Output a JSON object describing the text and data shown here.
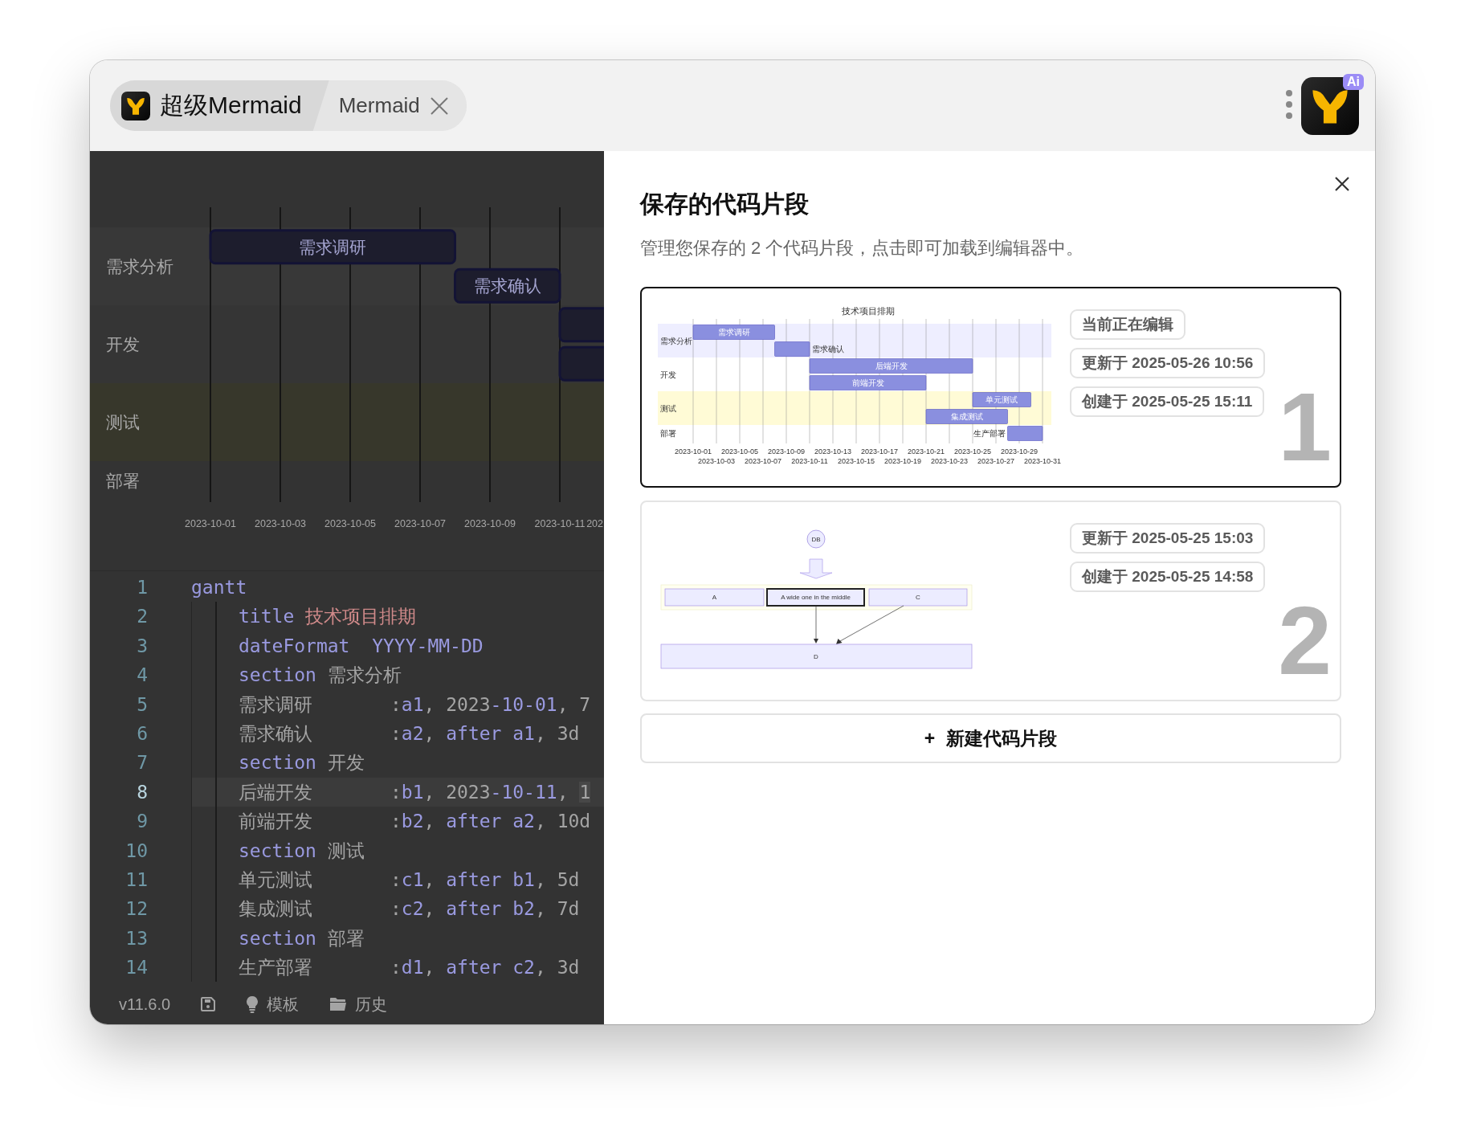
{
  "title_bar": {
    "tabs": [
      {
        "label": "超级Mermaid",
        "kind": "app",
        "selected": true
      },
      {
        "label": "Mermaid",
        "kind": "document",
        "selected": false
      }
    ],
    "assistant_badge": "Ai"
  },
  "preview": {
    "sections": [
      {
        "label": "需求分析",
        "tasks": [
          {
            "label": "需求调研",
            "kind": "labeled"
          },
          {
            "label": "需求确认",
            "kind": "labeled"
          }
        ]
      },
      {
        "label": "开发",
        "tasks": [
          {
            "kind": "bar"
          },
          {
            "kind": "bar"
          }
        ]
      },
      {
        "label": "测试"
      },
      {
        "label": "部署"
      }
    ],
    "axis_labels": [
      "2023-10-01",
      "2023-10-03",
      "2023-10-05",
      "2023-10-07",
      "2023-10-09",
      "2023-10-11",
      "202"
    ]
  },
  "editor": {
    "lines": [
      {
        "number": "1",
        "current": false,
        "tokens": [
          {
            "text": "gantt",
            "kind": "keyword"
          }
        ],
        "children": [
          {
            "number": "2",
            "current": false,
            "tokens": [
              {
                "text": "title",
                "kind": "keyword"
              },
              {
                "text": " 技术项目排期",
                "kind": "string"
              }
            ]
          },
          {
            "number": "3",
            "current": false,
            "tokens": [
              {
                "text": "dateFormat  YYYY-MM-DD",
                "kind": "keyword"
              }
            ]
          },
          {
            "number": "4",
            "current": false,
            "tokens": [
              {
                "text": "section",
                "kind": "keyword"
              },
              {
                "text": " 需求分析",
                "kind": "plain"
              }
            ]
          },
          {
            "number": "5",
            "current": false,
            "tokens": [
              {
                "text": "需求调研       :",
                "kind": "plain"
              },
              {
                "text": "a1",
                "kind": "keyword"
              },
              {
                "text": ", 2023",
                "kind": "plain"
              },
              {
                "text": "-10-01",
                "kind": "keyword"
              },
              {
                "text": ", 7",
                "kind": "plain"
              }
            ]
          },
          {
            "number": "6",
            "current": false,
            "tokens": [
              {
                "text": "需求确认       :",
                "kind": "plain"
              },
              {
                "text": "a2",
                "kind": "keyword"
              },
              {
                "text": ", ",
                "kind": "plain"
              },
              {
                "text": "after a1",
                "kind": "keyword"
              },
              {
                "text": ", 3d",
                "kind": "plain"
              }
            ]
          },
          {
            "number": "7",
            "current": false,
            "tokens": [
              {
                "text": "section",
                "kind": "keyword"
              },
              {
                "text": " 开发",
                "kind": "plain"
              }
            ]
          },
          {
            "number": "8",
            "current": true,
            "tokens": [
              {
                "text": "后端开发       :",
                "kind": "plain"
              },
              {
                "text": "b1",
                "kind": "keyword"
              },
              {
                "text": ", 2023",
                "kind": "plain"
              },
              {
                "text": "-10-11",
                "kind": "keyword"
              },
              {
                "text": ", ",
                "kind": "plain"
              },
              {
                "text": "1",
                "kind": "cursor"
              }
            ]
          },
          {
            "number": "9",
            "current": false,
            "tokens": [
              {
                "text": "前端开发       :",
                "kind": "plain"
              },
              {
                "text": "b2",
                "kind": "keyword"
              },
              {
                "text": ", ",
                "kind": "plain"
              },
              {
                "text": "after a2",
                "kind": "keyword"
              },
              {
                "text": ", 10d",
                "kind": "plain"
              }
            ]
          },
          {
            "number": "10",
            "current": false,
            "tokens": [
              {
                "text": "section",
                "kind": "keyword"
              },
              {
                "text": " 测试",
                "kind": "plain"
              }
            ]
          },
          {
            "number": "11",
            "current": false,
            "tokens": [
              {
                "text": "单元测试       :",
                "kind": "plain"
              },
              {
                "text": "c1",
                "kind": "keyword"
              },
              {
                "text": ", ",
                "kind": "plain"
              },
              {
                "text": "after b1",
                "kind": "keyword"
              },
              {
                "text": ", 5d",
                "kind": "plain"
              }
            ]
          },
          {
            "number": "12",
            "current": false,
            "tokens": [
              {
                "text": "集成测试       :",
                "kind": "plain"
              },
              {
                "text": "c2",
                "kind": "keyword"
              },
              {
                "text": ", ",
                "kind": "plain"
              },
              {
                "text": "after b2",
                "kind": "keyword"
              },
              {
                "text": ", 7d",
                "kind": "plain"
              }
            ]
          },
          {
            "number": "13",
            "current": false,
            "tokens": [
              {
                "text": "section",
                "kind": "keyword"
              },
              {
                "text": " 部署",
                "kind": "plain"
              }
            ]
          },
          {
            "number": "14",
            "current": false,
            "tokens": [
              {
                "text": "生产部署       :",
                "kind": "plain"
              },
              {
                "text": "d1",
                "kind": "keyword"
              },
              {
                "text": ", ",
                "kind": "plain"
              },
              {
                "text": "after c2",
                "kind": "keyword"
              },
              {
                "text": ", 3d",
                "kind": "plain"
              }
            ]
          }
        ]
      }
    ]
  },
  "status_bar": {
    "version": "v11.6.0",
    "buttons": [
      {
        "kind": "save"
      },
      {
        "kind": "templates",
        "label": "模板"
      },
      {
        "kind": "history",
        "label": "历史"
      }
    ]
  },
  "modal": {
    "title": "保存的代码片段",
    "subtitle": "管理您保存的 2 个代码片段，点击即可加载到编辑器中。",
    "snippets": [
      {
        "number": "1",
        "selected": true,
        "badges": [
          "当前正在编辑",
          "更新于 2025-05-26 10:56",
          "创建于 2025-05-25 15:11"
        ],
        "thumbnail": {
          "kind": "gantt",
          "title": "技术项目排期",
          "sections": [
            {
              "label": "需求分析",
              "tasks": [
                {
                  "label": "需求调研"
                },
                {
                  "label": "需求确认"
                }
              ]
            },
            {
              "label": "开发",
              "tasks": [
                {
                  "label": "后端开发"
                },
                {
                  "label": "前端开发"
                }
              ]
            },
            {
              "label": "测试",
              "tasks": [
                {
                  "label": "单元测试"
                },
                {
                  "label": "集成测试"
                }
              ]
            },
            {
              "label": "部署",
              "tasks": [
                {
                  "label": "生产部署"
                }
              ]
            }
          ],
          "axis_labels": [
            "2023-10-01",
            "2023-10-03",
            "2023-10-05",
            "2023-10-07",
            "2023-10-09",
            "2023-10-11",
            "2023-10-13",
            "2023-10-15",
            "2023-10-17",
            "2023-10-19",
            "2023-10-21",
            "2023-10-23",
            "2023-10-25",
            "2023-10-27",
            "2023-10-29",
            "2023-10-31"
          ]
        }
      },
      {
        "number": "2",
        "selected": false,
        "badges": [
          "更新于 2025-05-25 15:03",
          "创建于 2025-05-25 14:58"
        ],
        "thumbnail": {
          "kind": "flowchart",
          "circle": "DB",
          "row": [
            {
              "label": "A",
              "emphasized": false
            },
            {
              "label": "A wide one in the middle",
              "emphasized": true
            },
            {
              "label": "C",
              "emphasized": false
            }
          ],
          "bottom": "D"
        }
      }
    ],
    "new_button": {
      "icon": "+",
      "label": "新建代码片段"
    }
  }
}
